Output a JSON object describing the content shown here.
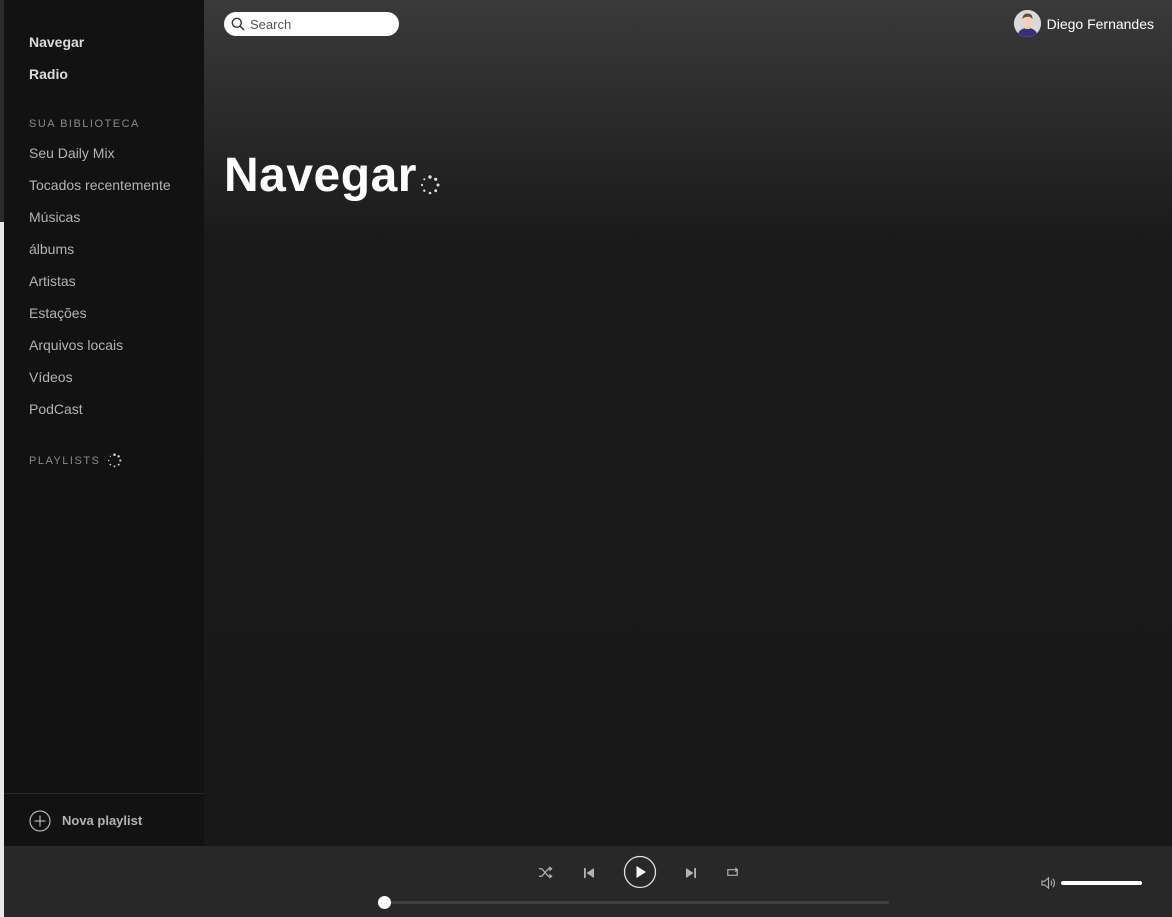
{
  "sidebar": {
    "nav": [
      {
        "label": "Navegar"
      },
      {
        "label": "Radio"
      }
    ],
    "library_title": "SUA BIBLIOTECA",
    "library": [
      {
        "label": "Seu Daily Mix"
      },
      {
        "label": "Tocados recentemente"
      },
      {
        "label": "Músicas"
      },
      {
        "label": "álbums"
      },
      {
        "label": "Artistas"
      },
      {
        "label": "Estações"
      },
      {
        "label": "Arquivos locais"
      },
      {
        "label": "Vídeos"
      },
      {
        "label": "PodCast"
      }
    ],
    "playlists_title": "PLAYLISTS",
    "new_playlist_label": "Nova playlist"
  },
  "header": {
    "search_placeholder": "Search",
    "user_name": "Diego Fernandes"
  },
  "main": {
    "title": "Navegar"
  },
  "player": {
    "progress_fraction": 0,
    "volume_fraction": 1.0
  },
  "colors": {
    "background": "#121212",
    "player_background": "#282828",
    "text_primary": "#ffffff",
    "text_secondary": "#b3b3b3"
  },
  "icons": {
    "search": "search-icon",
    "add": "plus-circle-icon",
    "shuffle": "shuffle-icon",
    "previous": "skip-back-icon",
    "play": "play-icon",
    "next": "skip-forward-icon",
    "repeat": "repeat-icon",
    "volume": "volume-icon",
    "loading": "loading-spinner-icon"
  }
}
